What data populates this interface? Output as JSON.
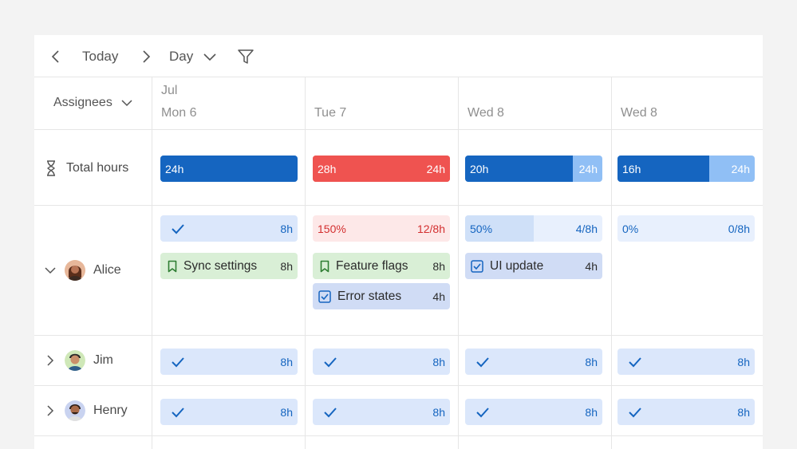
{
  "toolbar": {
    "prev_icon": "chevron-left-icon",
    "today_label": "Today",
    "next_icon": "chevron-right-icon",
    "view_label": "Day",
    "view_icon": "chevron-down-icon",
    "filter_icon": "filter-icon"
  },
  "header": {
    "assignees_label": "Assignees",
    "month": "Jul",
    "days": [
      "Mon 6",
      "Tue 7",
      "Wed 8",
      "Wed 8"
    ]
  },
  "total_row": {
    "label": "Total hours",
    "icon": "hourglass-icon",
    "cells": [
      {
        "left": "24h",
        "right": "",
        "fill": 1.0,
        "status": "normal"
      },
      {
        "left": "28h",
        "right": "24h",
        "fill": 1.0,
        "status": "over"
      },
      {
        "left": "20h",
        "right": "24h",
        "fill": 0.7833,
        "status": "normal"
      },
      {
        "left": "16h",
        "right": "24h",
        "fill": 0.6667,
        "status": "normal"
      }
    ]
  },
  "rows": [
    {
      "name": "Alice",
      "expanded": true,
      "summary": [
        {
          "type": "check",
          "right": "8h",
          "fill": 1.0
        },
        {
          "type": "over",
          "left": "150%",
          "right": "12/8h",
          "fill": 1.0
        },
        {
          "type": "percent",
          "left": "50%",
          "right": "4/8h",
          "fill": 0.5
        },
        {
          "type": "percent",
          "left": "0%",
          "right": "0/8h",
          "fill": 0.0
        }
      ],
      "tasks": [
        [
          {
            "icon": "bookmark-icon",
            "kind": "green",
            "label": "Sync settings",
            "hours": "8h"
          }
        ],
        [
          {
            "icon": "bookmark-icon",
            "kind": "green",
            "label": "Feature flags",
            "hours": "8h"
          },
          {
            "icon": "checkbox-icon",
            "kind": "blue",
            "label": "Error states",
            "hours": "4h"
          }
        ],
        [
          {
            "icon": "checkbox-icon",
            "kind": "blue",
            "label": "UI update",
            "hours": "4h"
          }
        ],
        []
      ]
    },
    {
      "name": "Jim",
      "expanded": false,
      "summary": [
        {
          "type": "check",
          "right": "8h",
          "fill": 1.0
        },
        {
          "type": "check",
          "right": "8h",
          "fill": 1.0
        },
        {
          "type": "check",
          "right": "8h",
          "fill": 1.0
        },
        {
          "type": "check",
          "right": "8h",
          "fill": 1.0
        }
      ]
    },
    {
      "name": "Henry",
      "expanded": false,
      "summary": [
        {
          "type": "check",
          "right": "8h",
          "fill": 1.0
        },
        {
          "type": "check",
          "right": "8h",
          "fill": 1.0
        },
        {
          "type": "check",
          "right": "8h",
          "fill": 1.0
        },
        {
          "type": "check",
          "right": "8h",
          "fill": 1.0
        }
      ]
    }
  ],
  "colors": {
    "blue_dark": "#1565c0",
    "blue_light": "#90bff5",
    "red": "#ef5350",
    "red_light_bg": "#fde8e8",
    "red_text": "#d32f2f",
    "chip_blue_bg": "#dbe7fb",
    "chip_blue_text": "#1565c0",
    "task_blue_bg": "#d0dcf5",
    "task_green_bg": "#d9efd6",
    "task_green_icon": "#2e7d32",
    "pct_fill": "#cfe0f8",
    "pct_bg": "#e8f0fd"
  }
}
